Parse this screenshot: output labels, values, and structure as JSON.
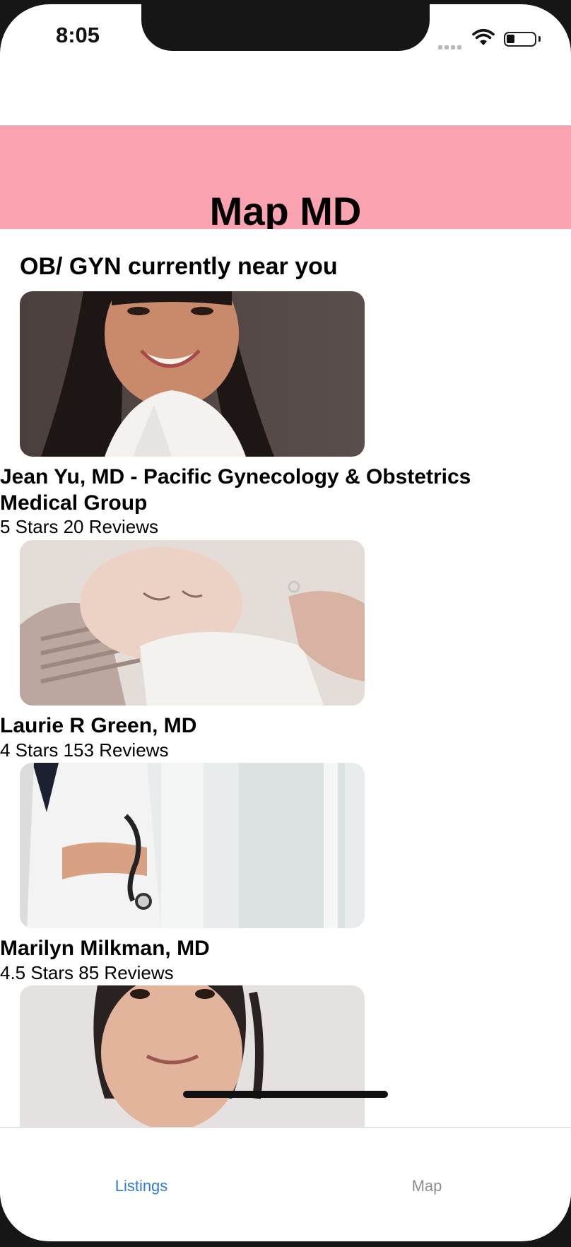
{
  "status_bar": {
    "time": "8:05"
  },
  "header": {
    "title": "Map MD",
    "background_color": "#fba3b1"
  },
  "section": {
    "title": "OB/ GYN currently near you"
  },
  "listings": [
    {
      "name": "Jean Yu, MD - Pacific Gynecology & Obstetrics Medical Group",
      "rating": "5 Stars 20 Reviews",
      "photo": "doctor-portrait-photo"
    },
    {
      "name": "Laurie R Green, MD",
      "rating": "4 Stars 153 Reviews",
      "photo": "newborn-baby-photo"
    },
    {
      "name": "Marilyn Milkman, MD",
      "rating": "4.5 Stars 85 Reviews",
      "photo": "doctor-stethoscope-photo"
    },
    {
      "photo": "doctor-portrait-photo"
    }
  ],
  "tabs": [
    {
      "label": "Listings",
      "selected": true,
      "color": "#2f7cd6"
    },
    {
      "label": "Map",
      "selected": false,
      "color": "#8e8e8e"
    }
  ]
}
